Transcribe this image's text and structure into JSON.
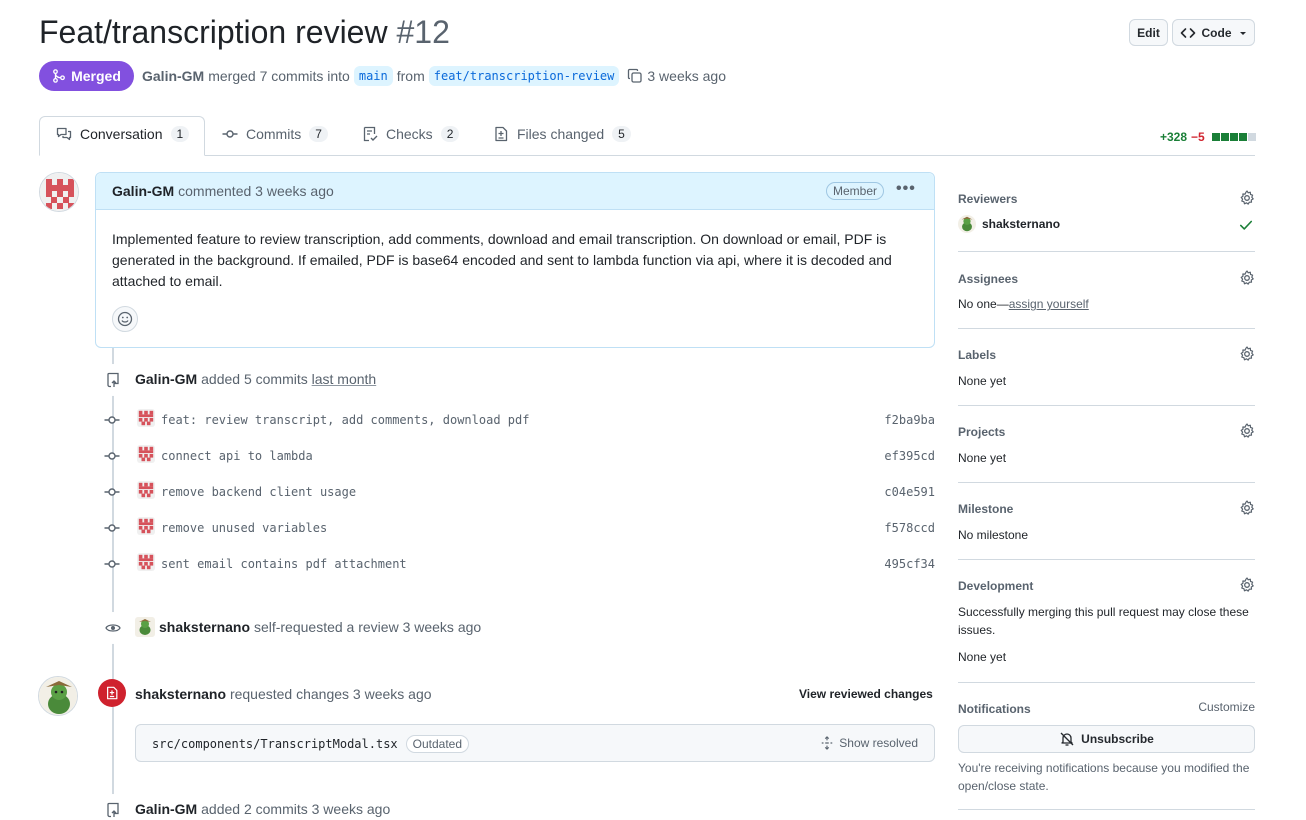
{
  "pr": {
    "title": "Feat/transcription review",
    "number": "#12",
    "status": "Merged",
    "author": "Galin-GM",
    "merge_text": "merged 7 commits into",
    "base_branch": "main",
    "from_text": "from",
    "head_branch": "feat/transcription-review",
    "time": "3 weeks ago"
  },
  "header_buttons": {
    "edit": "Edit",
    "code": "Code"
  },
  "tabs": [
    {
      "label": "Conversation",
      "count": "1"
    },
    {
      "label": "Commits",
      "count": "7"
    },
    {
      "label": "Checks",
      "count": "2"
    },
    {
      "label": "Files changed",
      "count": "5"
    }
  ],
  "diffstat": {
    "additions": "+328",
    "deletions": "−5"
  },
  "comment": {
    "author": "Galin-GM",
    "action": "commented 3 weeks ago",
    "badge": "Member",
    "body": "Implemented feature to review transcription, add comments, download and email transcription. On download or email, PDF is generated in the background. If emailed, PDF is base64 encoded and sent to lambda function via api, where it is decoded and attached to email."
  },
  "commits_event": {
    "author": "Galin-GM",
    "action": "added 5 commits",
    "time": "last month"
  },
  "commits": [
    {
      "message": "feat: review transcript, add comments, download pdf",
      "sha": "f2ba9ba"
    },
    {
      "message": "connect api to lambda",
      "sha": "ef395cd"
    },
    {
      "message": "remove backend client usage",
      "sha": "c04e591"
    },
    {
      "message": "remove unused variables",
      "sha": "f578ccd"
    },
    {
      "message": "sent email contains pdf attachment",
      "sha": "495cf34"
    }
  ],
  "review_request": {
    "author": "shaksternano",
    "action": "self-requested a review 3 weeks ago"
  },
  "review": {
    "author": "shaksternano",
    "action": "requested changes 3 weeks ago",
    "link": "View reviewed changes",
    "file": "src/components/TranscriptModal.tsx",
    "file_badge": "Outdated",
    "show_resolved": "Show resolved"
  },
  "commits_event2": {
    "author": "Galin-GM",
    "action": "added 2 commits 3 weeks ago"
  },
  "sidebar": {
    "reviewers": {
      "title": "Reviewers",
      "name": "shaksternano"
    },
    "assignees": {
      "title": "Assignees",
      "value": "No one—",
      "link": "assign yourself"
    },
    "labels": {
      "title": "Labels",
      "value": "None yet"
    },
    "projects": {
      "title": "Projects",
      "value": "None yet"
    },
    "milestone": {
      "title": "Milestone",
      "value": "No milestone"
    },
    "development": {
      "title": "Development",
      "desc": "Successfully merging this pull request may close these issues.",
      "value": "None yet"
    },
    "notifications": {
      "title": "Notifications",
      "customize": "Customize",
      "button": "Unsubscribe",
      "desc": "You're receiving notifications because you modified the open/close state."
    }
  },
  "colors": {
    "merged": "#8250df",
    "addition": "#1a7f37",
    "deletion": "#d1242f",
    "comment_header": "#ddf4ff",
    "changes_requested": "#cf222e"
  }
}
